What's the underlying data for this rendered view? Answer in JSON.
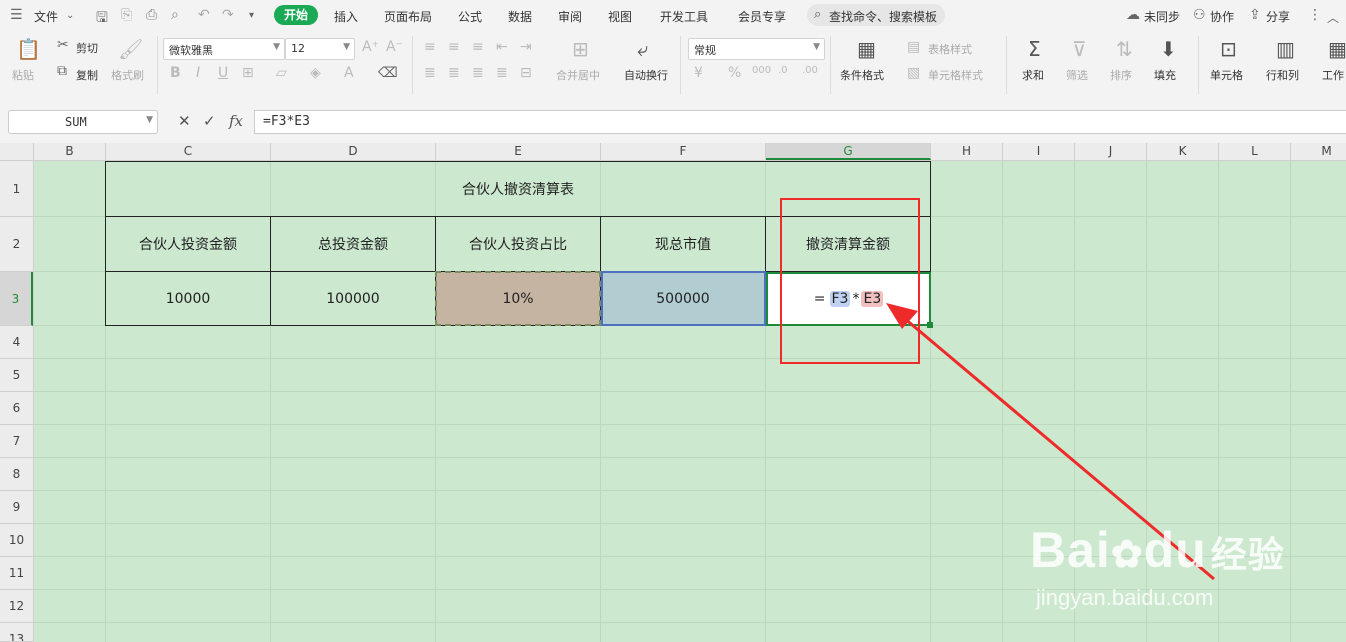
{
  "menu": {
    "file": "文件",
    "tabs": [
      "开始",
      "插入",
      "页面布局",
      "公式",
      "数据",
      "审阅",
      "视图",
      "开发工具",
      "会员专享"
    ],
    "search_placeholder": "查找命令、搜索模板",
    "sync": "未同步",
    "collab": "协作",
    "share": "分享"
  },
  "ribbon": {
    "paste": "粘贴",
    "cut": "剪切",
    "copy": "复制",
    "format_painter": "格式刷",
    "font_name": "微软雅黑",
    "font_size": "12",
    "merge_center": "合并居中",
    "wrap_text": "自动换行",
    "number_format": "常规",
    "conditional_format": "条件格式",
    "table_style": "表格样式",
    "cell_style": "单元格样式",
    "sum": "求和",
    "filter": "筛选",
    "sort": "排序",
    "fill": "填充",
    "cell": "单元格",
    "row_col": "行和列",
    "worksheet": "工作"
  },
  "formula_bar": {
    "name_box": "SUM",
    "formula": "=F3*E3"
  },
  "columns": [
    "B",
    "C",
    "D",
    "E",
    "F",
    "G",
    "H",
    "I",
    "J",
    "K",
    "L",
    "M"
  ],
  "rows": [
    "1",
    "2",
    "3",
    "4",
    "5",
    "6",
    "7",
    "8",
    "9",
    "10",
    "11",
    "12",
    "13"
  ],
  "table": {
    "title": "合伙人撤资清算表",
    "headers": [
      "合伙人投资金额",
      "总投资金额",
      "合伙人投资占比",
      "现总市值",
      "撤资清算金额"
    ],
    "values": [
      "10000",
      "100000",
      "10%",
      "500000"
    ],
    "editing": {
      "eq": "=",
      "ref1": "F3",
      "op": "*",
      "ref2": "E3"
    }
  },
  "watermark": {
    "brand_a": "Bai",
    "brand_b": "du",
    "brand_c": "经验",
    "url": "jingyan.baidu.com"
  },
  "colors": {
    "accent_green": "#1aaa55",
    "sheet_bg": "#cce8cf",
    "annotation_red": "#ee2a2a"
  }
}
